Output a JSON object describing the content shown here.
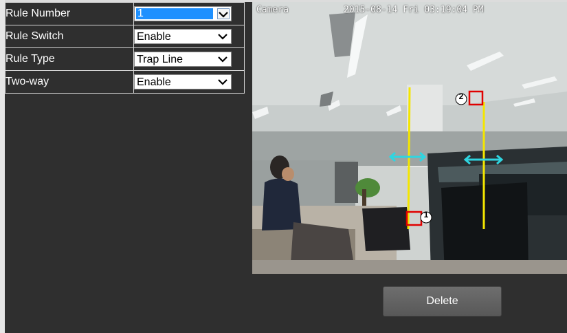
{
  "rules": [
    {
      "label": "Rule Number",
      "value": "1",
      "highlighted": true
    },
    {
      "label": "Rule Switch",
      "value": "Enable",
      "highlighted": false
    },
    {
      "label": "Rule Type",
      "value": "Trap Line",
      "highlighted": false
    },
    {
      "label": "Two-way",
      "value": "Enable",
      "highlighted": false
    }
  ],
  "camera": {
    "name": "Camera",
    "timestamp": "2015-08-14 Fri 03:19:04 PM",
    "markers": [
      {
        "label": "1"
      },
      {
        "label": "2"
      }
    ],
    "line_color": "#f4e600",
    "direction_color": "#2fd5e0",
    "marker_color": "#e00000"
  },
  "actions": {
    "delete_label": "Delete"
  },
  "icons": {
    "dropdown": "chevron-down-icon"
  }
}
